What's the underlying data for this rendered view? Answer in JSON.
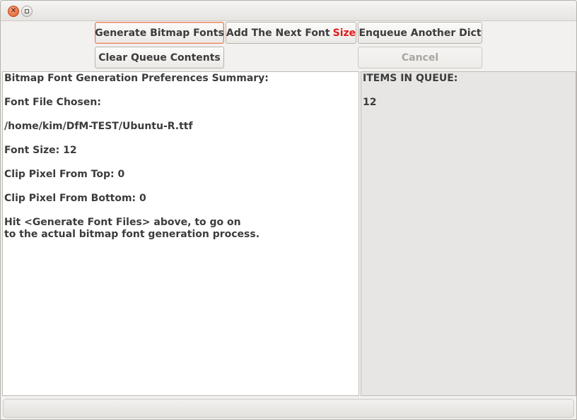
{
  "toolbar": {
    "generate_label": "Generate Bitmap Fonts",
    "add_next_label": "Add The Next Font",
    "add_next_highlight": "Size",
    "enqueue_label": "Enqueue Another Dict",
    "clear_label": "Clear Queue Contents",
    "cancel_label": "Cancel"
  },
  "summary": {
    "title": "Bitmap Font Generation Preferences Summary:",
    "font_file_label": "Font File Chosen:",
    "font_path": "/home/kim/DfM-TEST/Ubuntu-R.ttf",
    "font_size": "Font Size: 12",
    "clip_top": "Clip Pixel From Top: 0",
    "clip_bottom": "Clip Pixel From Bottom: 0",
    "hint_line1": "Hit <Generate Font Files> above, to go on",
    "hint_line2": "to the actual bitmap font generation process."
  },
  "queue": {
    "title": "ITEMS IN QUEUE:",
    "count": "12"
  },
  "colors": {
    "accent_focus": "#e3835b",
    "highlight_red": "#df1a1a",
    "close_button": "#e2571f"
  }
}
